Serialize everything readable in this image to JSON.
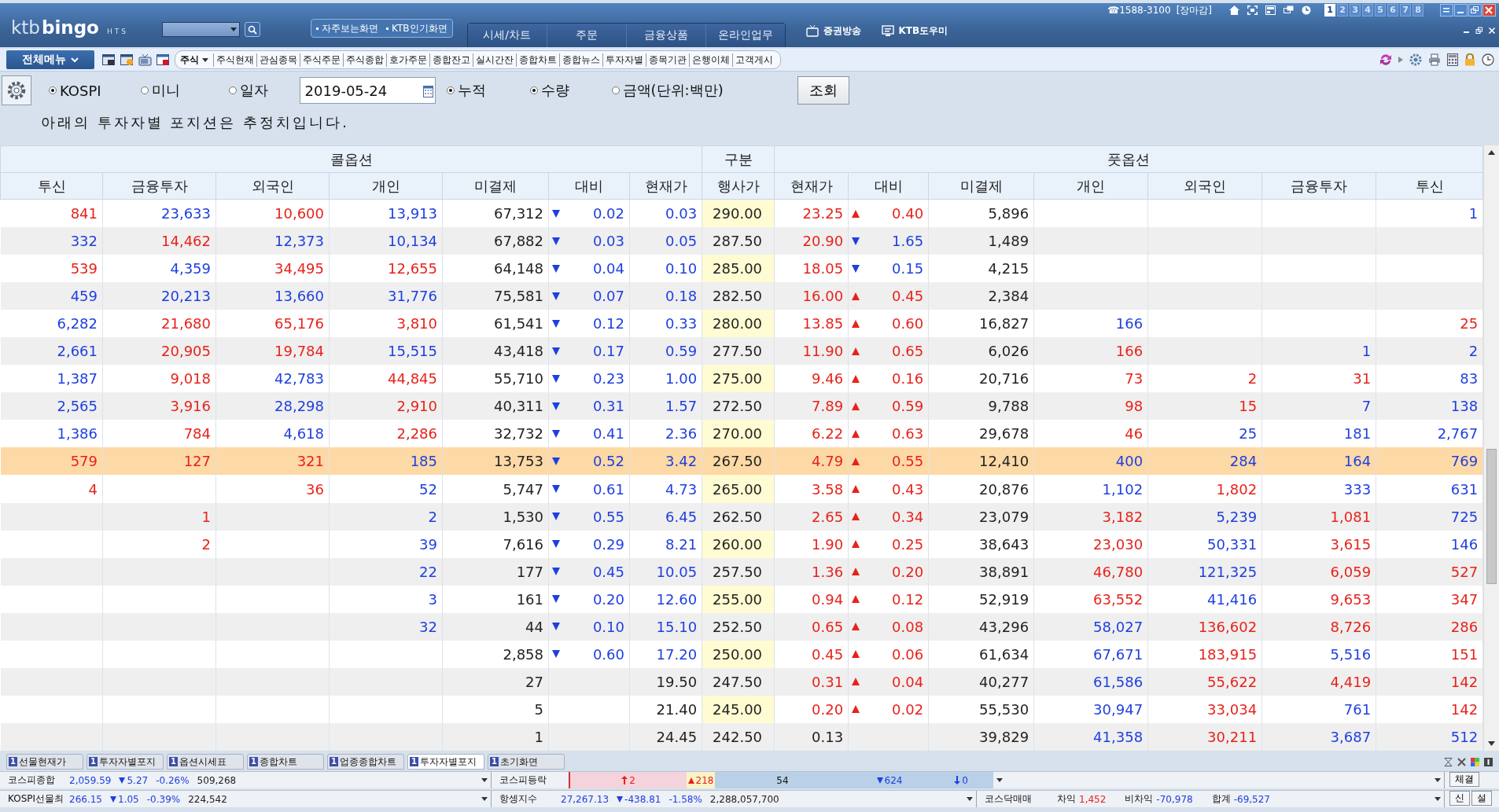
{
  "header": {
    "logo": {
      "brand": "ktb",
      "product": "bingo",
      "suffix": "HTS"
    },
    "quick_links": [
      "자주보는화면",
      "KTB인기화면"
    ],
    "main_tabs": [
      "시세/차트",
      "주문",
      "금융상품",
      "온라인업무"
    ],
    "links": [
      {
        "label": "증권방송",
        "kind": "tv"
      },
      {
        "label": "KTB도우미",
        "kind": "monitor"
      }
    ],
    "phone": "☎1588-3100",
    "market_status": "[장마감]",
    "screen_numbers": [
      {
        "label": "1",
        "selected": true
      },
      {
        "label": "2",
        "selected": false
      },
      {
        "label": "3",
        "selected": false
      },
      {
        "label": "4",
        "selected": false
      },
      {
        "label": "5",
        "selected": false
      },
      {
        "label": "6",
        "selected": false
      },
      {
        "label": "7",
        "selected": false
      },
      {
        "label": "8",
        "selected": false
      }
    ]
  },
  "toolbar": {
    "menu_button": "전체메뉴",
    "category": "주식",
    "items": [
      "주식현재",
      "관심종목",
      "주식주문",
      "주식종합",
      "호가주문",
      "종합잔고",
      "실시간잔",
      "종합차트",
      "종합뉴스",
      "투자자별",
      "종목기관",
      "은행이체",
      "고객게시"
    ]
  },
  "query": {
    "markets": [
      {
        "label": "KOSPI",
        "selected": true
      },
      {
        "label": "미니",
        "selected": false
      },
      {
        "label": "일자",
        "selected": false
      }
    ],
    "date": "2019-05-24",
    "cumulative": {
      "label": "누적",
      "selected": true
    },
    "units": [
      {
        "label": "수량",
        "selected": true
      },
      {
        "label": "금액(단위:백만)",
        "selected": false
      }
    ],
    "submit": "조회"
  },
  "notice": "아래의 투자자별 포지션은 추정치입니다.",
  "table": {
    "groups": [
      "콜옵션",
      "구분",
      "풋옵션"
    ],
    "columns": [
      "투신",
      "금융투자",
      "외국인",
      "개인",
      "미결제",
      "대비",
      "현재가",
      "행사가",
      "현재가",
      "대비",
      "미결제",
      "개인",
      "외국인",
      "금융투자",
      "투신"
    ],
    "rows": [
      {
        "selected": false,
        "call": {
          "investors": {
            "trust": {
              "value": "841",
              "color": "#e8221a"
            },
            "financial": {
              "value": "23,633",
              "color": "#1e3fe0"
            },
            "foreign": {
              "value": "10,600",
              "color": "#e8221a"
            },
            "individual": {
              "value": "13,913",
              "color": "#1e3fe0"
            }
          },
          "open_interest": "67,312",
          "change": {
            "value": "0.02",
            "rising": false
          },
          "price": {
            "value": "0.03",
            "color": "#1e3fe0"
          }
        },
        "strike": "290.00",
        "put": {
          "price": {
            "value": "23.25",
            "color": "#e8221a"
          },
          "change": {
            "value": "0.40",
            "rising": true
          },
          "open_interest": "5,896",
          "investors": {
            "trust": {
              "value": "1",
              "color": "#1e3fe0"
            }
          }
        }
      },
      {
        "selected": false,
        "call": {
          "investors": {
            "trust": {
              "value": "332",
              "color": "#1e3fe0"
            },
            "financial": {
              "value": "14,462",
              "color": "#e8221a"
            },
            "foreign": {
              "value": "12,373",
              "color": "#1e3fe0"
            },
            "individual": {
              "value": "10,134",
              "color": "#1e3fe0"
            }
          },
          "open_interest": "67,882",
          "change": {
            "value": "0.03",
            "rising": false
          },
          "price": {
            "value": "0.05",
            "color": "#1e3fe0"
          }
        },
        "strike": "287.50",
        "put": {
          "price": {
            "value": "20.90",
            "color": "#e8221a"
          },
          "change": {
            "value": "1.65",
            "rising": false
          },
          "open_interest": "1,489"
        }
      },
      {
        "selected": false,
        "call": {
          "investors": {
            "trust": {
              "value": "539",
              "color": "#e8221a"
            },
            "financial": {
              "value": "4,359",
              "color": "#1e3fe0"
            },
            "foreign": {
              "value": "34,495",
              "color": "#e8221a"
            },
            "individual": {
              "value": "12,655",
              "color": "#e8221a"
            }
          },
          "open_interest": "64,148",
          "change": {
            "value": "0.04",
            "rising": false
          },
          "price": {
            "value": "0.10",
            "color": "#1e3fe0"
          }
        },
        "strike": "285.00",
        "put": {
          "price": {
            "value": "18.05",
            "color": "#e8221a"
          },
          "change": {
            "value": "0.15",
            "rising": false
          },
          "open_interest": "4,215"
        }
      },
      {
        "selected": false,
        "call": {
          "investors": {
            "trust": {
              "value": "459",
              "color": "#1e3fe0"
            },
            "financial": {
              "value": "20,213",
              "color": "#1e3fe0"
            },
            "foreign": {
              "value": "13,660",
              "color": "#1e3fe0"
            },
            "individual": {
              "value": "31,776",
              "color": "#1e3fe0"
            }
          },
          "open_interest": "75,581",
          "change": {
            "value": "0.07",
            "rising": false
          },
          "price": {
            "value": "0.18",
            "color": "#1e3fe0"
          }
        },
        "strike": "282.50",
        "put": {
          "price": {
            "value": "16.00",
            "color": "#e8221a"
          },
          "change": {
            "value": "0.45",
            "rising": true
          },
          "open_interest": "2,384"
        }
      },
      {
        "selected": false,
        "call": {
          "investors": {
            "trust": {
              "value": "6,282",
              "color": "#1e3fe0"
            },
            "financial": {
              "value": "21,680",
              "color": "#e8221a"
            },
            "foreign": {
              "value": "65,176",
              "color": "#e8221a"
            },
            "individual": {
              "value": "3,810",
              "color": "#e8221a"
            }
          },
          "open_interest": "61,541",
          "change": {
            "value": "0.12",
            "rising": false
          },
          "price": {
            "value": "0.33",
            "color": "#1e3fe0"
          }
        },
        "strike": "280.00",
        "put": {
          "price": {
            "value": "13.85",
            "color": "#e8221a"
          },
          "change": {
            "value": "0.60",
            "rising": true
          },
          "open_interest": "16,827",
          "investors": {
            "individual": {
              "value": "166",
              "color": "#1e3fe0"
            },
            "trust": {
              "value": "25",
              "color": "#e8221a"
            }
          }
        }
      },
      {
        "selected": false,
        "call": {
          "investors": {
            "trust": {
              "value": "2,661",
              "color": "#1e3fe0"
            },
            "financial": {
              "value": "20,905",
              "color": "#e8221a"
            },
            "foreign": {
              "value": "19,784",
              "color": "#e8221a"
            },
            "individual": {
              "value": "15,515",
              "color": "#1e3fe0"
            }
          },
          "open_interest": "43,418",
          "change": {
            "value": "0.17",
            "rising": false
          },
          "price": {
            "value": "0.59",
            "color": "#1e3fe0"
          }
        },
        "strike": "277.50",
        "put": {
          "price": {
            "value": "11.90",
            "color": "#e8221a"
          },
          "change": {
            "value": "0.65",
            "rising": true
          },
          "open_interest": "6,026",
          "investors": {
            "individual": {
              "value": "166",
              "color": "#e8221a"
            },
            "financial": {
              "value": "1",
              "color": "#1e3fe0"
            },
            "trust": {
              "value": "2",
              "color": "#1e3fe0"
            }
          }
        }
      },
      {
        "selected": false,
        "call": {
          "investors": {
            "trust": {
              "value": "1,387",
              "color": "#1e3fe0"
            },
            "financial": {
              "value": "9,018",
              "color": "#e8221a"
            },
            "foreign": {
              "value": "42,783",
              "color": "#1e3fe0"
            },
            "individual": {
              "value": "44,845",
              "color": "#e8221a"
            }
          },
          "open_interest": "55,710",
          "change": {
            "value": "0.23",
            "rising": false
          },
          "price": {
            "value": "1.00",
            "color": "#1e3fe0"
          }
        },
        "strike": "275.00",
        "put": {
          "price": {
            "value": "9.46",
            "color": "#e8221a"
          },
          "change": {
            "value": "0.16",
            "rising": true
          },
          "open_interest": "20,716",
          "investors": {
            "individual": {
              "value": "73",
              "color": "#e8221a"
            },
            "foreign": {
              "value": "2",
              "color": "#e8221a"
            },
            "financial": {
              "value": "31",
              "color": "#e8221a"
            },
            "trust": {
              "value": "83",
              "color": "#1e3fe0"
            }
          }
        }
      },
      {
        "selected": false,
        "call": {
          "investors": {
            "trust": {
              "value": "2,565",
              "color": "#1e3fe0"
            },
            "financial": {
              "value": "3,916",
              "color": "#e8221a"
            },
            "foreign": {
              "value": "28,298",
              "color": "#1e3fe0"
            },
            "individual": {
              "value": "2,910",
              "color": "#e8221a"
            }
          },
          "open_interest": "40,311",
          "change": {
            "value": "0.31",
            "rising": false
          },
          "price": {
            "value": "1.57",
            "color": "#1e3fe0"
          }
        },
        "strike": "272.50",
        "put": {
          "price": {
            "value": "7.89",
            "color": "#e8221a"
          },
          "change": {
            "value": "0.59",
            "rising": true
          },
          "open_interest": "9,788",
          "investors": {
            "individual": {
              "value": "98",
              "color": "#e8221a"
            },
            "foreign": {
              "value": "15",
              "color": "#e8221a"
            },
            "financial": {
              "value": "7",
              "color": "#1e3fe0"
            },
            "trust": {
              "value": "138",
              "color": "#1e3fe0"
            }
          }
        }
      },
      {
        "selected": false,
        "call": {
          "investors": {
            "trust": {
              "value": "1,386",
              "color": "#1e3fe0"
            },
            "financial": {
              "value": "784",
              "color": "#e8221a"
            },
            "foreign": {
              "value": "4,618",
              "color": "#1e3fe0"
            },
            "individual": {
              "value": "2,286",
              "color": "#e8221a"
            }
          },
          "open_interest": "32,732",
          "change": {
            "value": "0.41",
            "rising": false
          },
          "price": {
            "value": "2.36",
            "color": "#1e3fe0"
          }
        },
        "strike": "270.00",
        "put": {
          "price": {
            "value": "6.22",
            "color": "#e8221a"
          },
          "change": {
            "value": "0.63",
            "rising": true
          },
          "open_interest": "29,678",
          "investors": {
            "individual": {
              "value": "46",
              "color": "#e8221a"
            },
            "foreign": {
              "value": "25",
              "color": "#1e3fe0"
            },
            "financial": {
              "value": "181",
              "color": "#1e3fe0"
            },
            "trust": {
              "value": "2,767",
              "color": "#1e3fe0"
            }
          }
        }
      },
      {
        "selected": true,
        "call": {
          "investors": {
            "trust": {
              "value": "579",
              "color": "#e8221a"
            },
            "financial": {
              "value": "127",
              "color": "#e8221a"
            },
            "foreign": {
              "value": "321",
              "color": "#e8221a"
            },
            "individual": {
              "value": "185",
              "color": "#1e3fe0"
            }
          },
          "open_interest": "13,753",
          "change": {
            "value": "0.52",
            "rising": false
          },
          "price": {
            "value": "3.42",
            "color": "#1e3fe0"
          }
        },
        "strike": "267.50",
        "put": {
          "price": {
            "value": "4.79",
            "color": "#e8221a"
          },
          "change": {
            "value": "0.55",
            "rising": true
          },
          "open_interest": "12,410",
          "investors": {
            "individual": {
              "value": "400",
              "color": "#1e3fe0"
            },
            "foreign": {
              "value": "284",
              "color": "#1e3fe0"
            },
            "financial": {
              "value": "164",
              "color": "#1e3fe0"
            },
            "trust": {
              "value": "769",
              "color": "#1e3fe0"
            }
          }
        }
      },
      {
        "selected": false,
        "call": {
          "investors": {
            "trust": {
              "value": "4",
              "color": "#e8221a"
            },
            "foreign": {
              "value": "36",
              "color": "#e8221a"
            },
            "individual": {
              "value": "52",
              "color": "#1e3fe0"
            }
          },
          "open_interest": "5,747",
          "change": {
            "value": "0.61",
            "rising": false
          },
          "price": {
            "value": "4.73",
            "color": "#1e3fe0"
          }
        },
        "strike": "265.00",
        "put": {
          "price": {
            "value": "3.58",
            "color": "#e8221a"
          },
          "change": {
            "value": "0.43",
            "rising": true
          },
          "open_interest": "20,876",
          "investors": {
            "individual": {
              "value": "1,102",
              "color": "#1e3fe0"
            },
            "foreign": {
              "value": "1,802",
              "color": "#e8221a"
            },
            "financial": {
              "value": "333",
              "color": "#1e3fe0"
            },
            "trust": {
              "value": "631",
              "color": "#1e3fe0"
            }
          }
        }
      },
      {
        "selected": false,
        "call": {
          "investors": {
            "financial": {
              "value": "1",
              "color": "#e8221a"
            },
            "individual": {
              "value": "2",
              "color": "#1e3fe0"
            }
          },
          "open_interest": "1,530",
          "change": {
            "value": "0.55",
            "rising": false
          },
          "price": {
            "value": "6.45",
            "color": "#1e3fe0"
          }
        },
        "strike": "262.50",
        "put": {
          "price": {
            "value": "2.65",
            "color": "#e8221a"
          },
          "change": {
            "value": "0.34",
            "rising": true
          },
          "open_interest": "23,079",
          "investors": {
            "individual": {
              "value": "3,182",
              "color": "#e8221a"
            },
            "foreign": {
              "value": "5,239",
              "color": "#1e3fe0"
            },
            "financial": {
              "value": "1,081",
              "color": "#e8221a"
            },
            "trust": {
              "value": "725",
              "color": "#1e3fe0"
            }
          }
        }
      },
      {
        "selected": false,
        "call": {
          "investors": {
            "financial": {
              "value": "2",
              "color": "#e8221a"
            },
            "individual": {
              "value": "39",
              "color": "#1e3fe0"
            }
          },
          "open_interest": "7,616",
          "change": {
            "value": "0.29",
            "rising": false
          },
          "price": {
            "value": "8.21",
            "color": "#1e3fe0"
          }
        },
        "strike": "260.00",
        "put": {
          "price": {
            "value": "1.90",
            "color": "#e8221a"
          },
          "change": {
            "value": "0.25",
            "rising": true
          },
          "open_interest": "38,643",
          "investors": {
            "individual": {
              "value": "23,030",
              "color": "#e8221a"
            },
            "foreign": {
              "value": "50,331",
              "color": "#1e3fe0"
            },
            "financial": {
              "value": "3,615",
              "color": "#e8221a"
            },
            "trust": {
              "value": "146",
              "color": "#1e3fe0"
            }
          }
        }
      },
      {
        "selected": false,
        "call": {
          "investors": {
            "individual": {
              "value": "22",
              "color": "#1e3fe0"
            }
          },
          "open_interest": "177",
          "change": {
            "value": "0.45",
            "rising": false
          },
          "price": {
            "value": "10.05",
            "color": "#1e3fe0"
          }
        },
        "strike": "257.50",
        "put": {
          "price": {
            "value": "1.36",
            "color": "#e8221a"
          },
          "change": {
            "value": "0.20",
            "rising": true
          },
          "open_interest": "38,891",
          "investors": {
            "individual": {
              "value": "46,780",
              "color": "#e8221a"
            },
            "foreign": {
              "value": "121,325",
              "color": "#1e3fe0"
            },
            "financial": {
              "value": "6,059",
              "color": "#e8221a"
            },
            "trust": {
              "value": "527",
              "color": "#e8221a"
            }
          }
        }
      },
      {
        "selected": false,
        "call": {
          "investors": {
            "individual": {
              "value": "3",
              "color": "#1e3fe0"
            }
          },
          "open_interest": "161",
          "change": {
            "value": "0.20",
            "rising": false
          },
          "price": {
            "value": "12.60",
            "color": "#1e3fe0"
          }
        },
        "strike": "255.00",
        "put": {
          "price": {
            "value": "0.94",
            "color": "#e8221a"
          },
          "change": {
            "value": "0.12",
            "rising": true
          },
          "open_interest": "52,919",
          "investors": {
            "individual": {
              "value": "63,552",
              "color": "#e8221a"
            },
            "foreign": {
              "value": "41,416",
              "color": "#1e3fe0"
            },
            "financial": {
              "value": "9,653",
              "color": "#e8221a"
            },
            "trust": {
              "value": "347",
              "color": "#e8221a"
            }
          }
        }
      },
      {
        "selected": false,
        "call": {
          "investors": {
            "individual": {
              "value": "32",
              "color": "#1e3fe0"
            }
          },
          "open_interest": "44",
          "change": {
            "value": "0.10",
            "rising": false
          },
          "price": {
            "value": "15.10",
            "color": "#1e3fe0"
          }
        },
        "strike": "252.50",
        "put": {
          "price": {
            "value": "0.65",
            "color": "#e8221a"
          },
          "change": {
            "value": "0.08",
            "rising": true
          },
          "open_interest": "43,296",
          "investors": {
            "individual": {
              "value": "58,027",
              "color": "#1e3fe0"
            },
            "foreign": {
              "value": "136,602",
              "color": "#e8221a"
            },
            "financial": {
              "value": "8,726",
              "color": "#e8221a"
            },
            "trust": {
              "value": "286",
              "color": "#e8221a"
            }
          }
        }
      },
      {
        "selected": false,
        "call": {
          "open_interest": "2,858",
          "change": {
            "value": "0.60",
            "rising": false
          },
          "price": {
            "value": "17.20",
            "color": "#1e3fe0"
          }
        },
        "strike": "250.00",
        "put": {
          "price": {
            "value": "0.45",
            "color": "#e8221a"
          },
          "change": {
            "value": "0.06",
            "rising": true
          },
          "open_interest": "61,634",
          "investors": {
            "individual": {
              "value": "67,671",
              "color": "#1e3fe0"
            },
            "foreign": {
              "value": "183,915",
              "color": "#e8221a"
            },
            "financial": {
              "value": "5,516",
              "color": "#1e3fe0"
            },
            "trust": {
              "value": "151",
              "color": "#e8221a"
            }
          }
        }
      },
      {
        "selected": false,
        "call": {
          "open_interest": "27",
          "price": {
            "value": "19.50",
            "color": "#222222"
          }
        },
        "strike": "247.50",
        "put": {
          "price": {
            "value": "0.31",
            "color": "#e8221a"
          },
          "change": {
            "value": "0.04",
            "rising": true
          },
          "open_interest": "40,277",
          "investors": {
            "individual": {
              "value": "61,586",
              "color": "#1e3fe0"
            },
            "foreign": {
              "value": "55,622",
              "color": "#e8221a"
            },
            "financial": {
              "value": "4,419",
              "color": "#e8221a"
            },
            "trust": {
              "value": "142",
              "color": "#e8221a"
            }
          }
        }
      },
      {
        "selected": false,
        "call": {
          "open_interest": "5",
          "price": {
            "value": "21.40",
            "color": "#222222"
          }
        },
        "strike": "245.00",
        "put": {
          "price": {
            "value": "0.20",
            "color": "#e8221a"
          },
          "change": {
            "value": "0.02",
            "rising": true
          },
          "open_interest": "55,530",
          "investors": {
            "individual": {
              "value": "30,947",
              "color": "#1e3fe0"
            },
            "foreign": {
              "value": "33,034",
              "color": "#e8221a"
            },
            "financial": {
              "value": "761",
              "color": "#1e3fe0"
            },
            "trust": {
              "value": "142",
              "color": "#e8221a"
            }
          }
        }
      },
      {
        "selected": false,
        "call": {
          "open_interest": "1",
          "price": {
            "value": "24.45",
            "color": "#222222"
          }
        },
        "strike": "242.50",
        "put": {
          "price": {
            "value": "0.13",
            "color": "#222222"
          },
          "open_interest": "39,829",
          "investors": {
            "individual": {
              "value": "41,358",
              "color": "#1e3fe0"
            },
            "foreign": {
              "value": "30,211",
              "color": "#e8221a"
            },
            "financial": {
              "value": "3,687",
              "color": "#1e3fe0"
            },
            "trust": {
              "value": "512",
              "color": "#1e3fe0"
            }
          }
        }
      }
    ]
  },
  "screen_tabs": [
    {
      "number": "1",
      "label": "선물현재가",
      "selected": false
    },
    {
      "number": "1",
      "label": "투자자별포지",
      "selected": false
    },
    {
      "number": "1",
      "label": "옵션시세표",
      "selected": false
    },
    {
      "number": "1",
      "label": "종합차트",
      "selected": false
    },
    {
      "number": "1",
      "label": "업종종합차트",
      "selected": false
    },
    {
      "number": "1",
      "label": "투자자별포지",
      "selected": true
    },
    {
      "number": "1",
      "label": "초기화면",
      "selected": false
    }
  ],
  "status_rows": [
    {
      "panels": [
        {
          "kind": "index",
          "label": "코스피종합",
          "value": "2,059.59",
          "change": "5.27",
          "rising": false,
          "rate": "-0.26%",
          "volume": "509,268"
        },
        {
          "kind": "breadth",
          "label": "코스피등락",
          "limit_up": "2",
          "up": "218",
          "unchanged": "54",
          "down": "624",
          "limit_down": "0"
        },
        {
          "kind": "blank"
        }
      ],
      "buttons": [
        "체결"
      ]
    },
    {
      "panels": [
        {
          "kind": "index",
          "label": "KOSPI선물최",
          "value": "266.15",
          "change": "1.05",
          "rising": false,
          "rate": "-0.39%",
          "volume": "224,542"
        },
        {
          "kind": "index",
          "label": "항셍지수",
          "value": "27,267.13",
          "change": "-438.81",
          "rising": false,
          "rate": "-1.58%",
          "volume": "2,288,057,700"
        },
        {
          "kind": "program",
          "label": "코스닥매매",
          "items": [
            {
              "label": "차익",
              "value": "1,452",
              "color": "#e8221a"
            },
            {
              "label": "비차익",
              "value": "-70,978",
              "color": "#1e3fe0"
            },
            {
              "label": "합계",
              "value": "-69,527",
              "color": "#1e3fe0"
            }
          ]
        }
      ],
      "buttons": [
        "신",
        "설"
      ]
    }
  ]
}
